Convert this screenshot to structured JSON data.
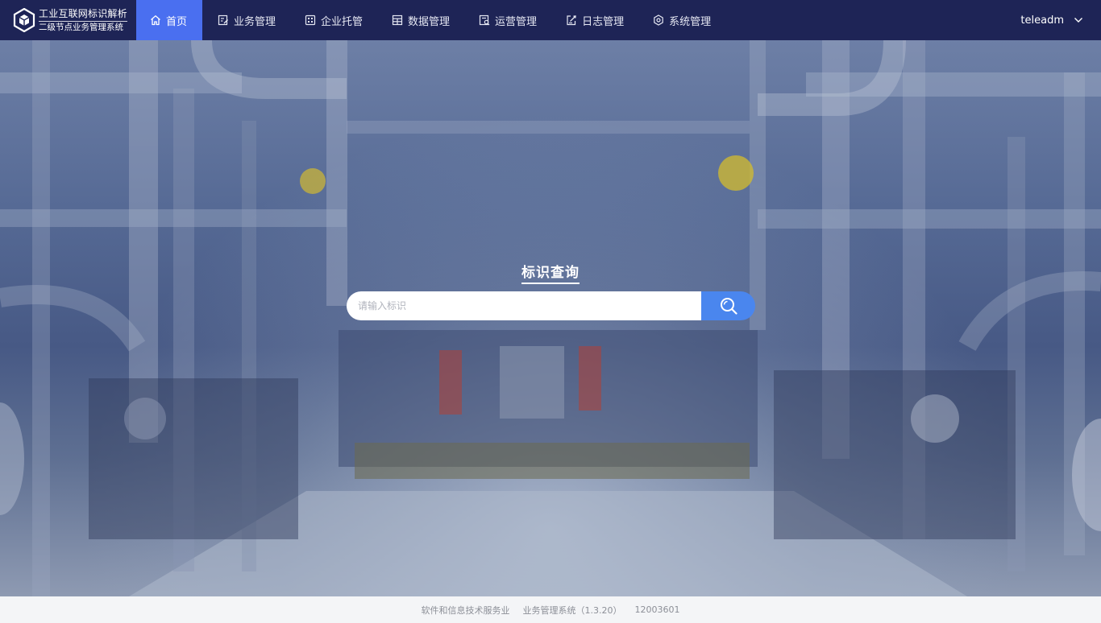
{
  "brand": {
    "title": "工业互联网标识解析",
    "subtitle": "二级节点业务管理系统",
    "logo_icon": "hexagon-cube-logo-icon"
  },
  "nav": {
    "items": [
      {
        "label": "首页",
        "icon": "home-icon",
        "active": true
      },
      {
        "label": "业务管理",
        "icon": "edit-doc-icon",
        "active": false
      },
      {
        "label": "企业托管",
        "icon": "building-icon",
        "active": false
      },
      {
        "label": "数据管理",
        "icon": "database-icon",
        "active": false
      },
      {
        "label": "运营管理",
        "icon": "report-icon",
        "active": false
      },
      {
        "label": "日志管理",
        "icon": "log-edit-icon",
        "active": false
      },
      {
        "label": "系统管理",
        "icon": "settings-icon",
        "active": false
      }
    ]
  },
  "user": {
    "name": "teleadm",
    "icon": "chevron-down-icon"
  },
  "search": {
    "title": "标识查询",
    "placeholder": "请输入标识",
    "value": "",
    "button_icon": "search-icon"
  },
  "footer": {
    "industry": "软件和信息技术服务业",
    "version": "业务管理系统（1.3.20）",
    "code": "12003601"
  },
  "colors": {
    "topbar": "#1e2456",
    "nav_active": "#4a6ff0",
    "search_button": "#4a86ee",
    "footer_bg": "#f4f5f7",
    "footer_text": "#8c8f97"
  }
}
